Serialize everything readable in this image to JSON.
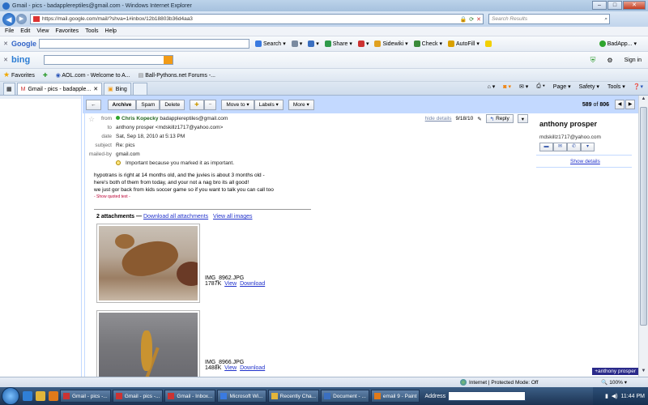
{
  "window": {
    "title": "Gmail - pics - badapplereptiles@gmail.com - Windows Internet Explorer",
    "min": "–",
    "max": "□",
    "close": "✕"
  },
  "address_bar": {
    "url": "https://mail.google.com/mail/?shva=1#inbox/12b18803b36d4aa3",
    "search_placeholder": "Search Results"
  },
  "menu": [
    "File",
    "Edit",
    "View",
    "Favorites",
    "Tools",
    "Help"
  ],
  "google_toolbar": {
    "logo": "Google",
    "items": [
      "Search",
      "Share",
      "Sidewiki",
      "Check",
      "AutoFill"
    ],
    "right": "BadApp..."
  },
  "bing_toolbar": {
    "logo": "bing",
    "sign_in": "Sign in"
  },
  "favorites_bar": {
    "label": "Favorites",
    "items": [
      "AOL.com - Welcome to A...",
      "Ball-Pythons.net Forums -..."
    ]
  },
  "tabs": [
    {
      "label": "Gmail - pics - badapple..."
    },
    {
      "label": "Bing"
    }
  ],
  "tab_tools": [
    "Page",
    "Safety",
    "Tools"
  ],
  "gmail": {
    "actions": {
      "back": "←",
      "archive": "Archive",
      "spam": "Spam",
      "delete": "Delete",
      "move_to": "Move to ▾",
      "labels": "Labels ▾",
      "more": "More ▾"
    },
    "count": {
      "current": "589",
      "of": "of",
      "total": "806"
    },
    "message": {
      "from_label": "from",
      "from_name": "Chris Kopecky",
      "from_email": "badapplereptiles@gmail.com",
      "to_label": "to",
      "to_value": "anthony prosper <mdskillz1717@yahoo.com>",
      "date_label": "date",
      "date_value": "Sat, Sep 18, 2010 at 5:13 PM",
      "subject_label": "subject",
      "subject_value": "Re: pics",
      "mailedby_label": "mailed-by",
      "mailedby_value": "gmail.com",
      "importance": "Important because you marked it as important.",
      "hide_details": "hide details",
      "date_short": "9/18/10",
      "reply": "Reply",
      "body_lines": [
        "hypotrans is right at 14 months old, and the juvies is about 3 months old -",
        "here's both of them from today, and your not a nag bro its all good!",
        "we just gor back from kids soccer game so if you want to talk you can call too"
      ],
      "quoted": "- Show quoted text -",
      "attachments_count": "2 attachments —",
      "download_all": "Download all attachments",
      "view_all_images": "View all images",
      "attachments": [
        {
          "name": "IMG_8962.JPG",
          "size": "1787K",
          "view": "View",
          "download": "Download"
        },
        {
          "name": "IMG_8966.JPG",
          "size": "1488K",
          "view": "View",
          "download": "Download"
        }
      ]
    },
    "contact": {
      "name": "anthony prosper",
      "email": "mdskillz1717@yahoo.com",
      "show_details": "Show details",
      "chat_chip": "+anthony prosper"
    }
  },
  "status_bar": {
    "zone": "Internet | Protected Mode: Off",
    "zoom": "100%"
  },
  "taskbar": {
    "items": [
      "Gmail - pics -...",
      "Gmail - pics -...",
      "Gmail - Inbox...",
      "Microsoft Wi...",
      "Recently Cha...",
      "Document - ...",
      "email 9 - Paint"
    ],
    "address_label": "Address",
    "time": "11:44 PM"
  }
}
